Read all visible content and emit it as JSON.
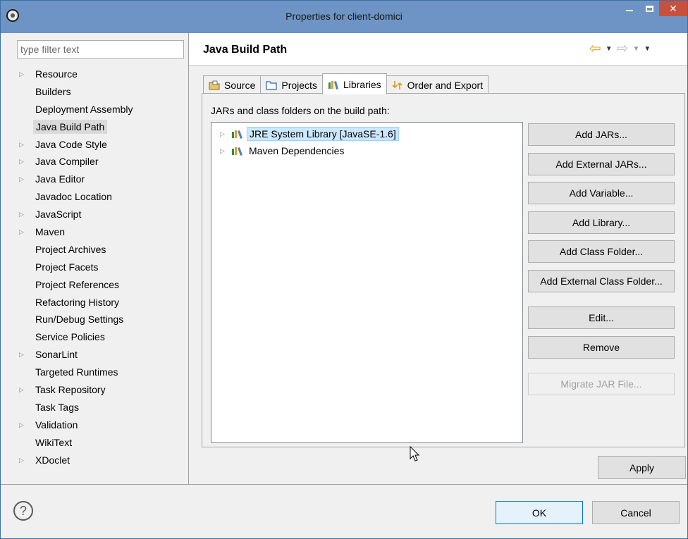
{
  "window": {
    "title": "Properties for client-domici"
  },
  "filter": {
    "placeholder": "type filter text"
  },
  "tree": {
    "items": [
      {
        "label": "Resource",
        "expandable": true
      },
      {
        "label": "Builders",
        "expandable": false
      },
      {
        "label": "Deployment Assembly",
        "expandable": false
      },
      {
        "label": "Java Build Path",
        "expandable": false,
        "selected": true
      },
      {
        "label": "Java Code Style",
        "expandable": true
      },
      {
        "label": "Java Compiler",
        "expandable": true
      },
      {
        "label": "Java Editor",
        "expandable": true
      },
      {
        "label": "Javadoc Location",
        "expandable": false
      },
      {
        "label": "JavaScript",
        "expandable": true
      },
      {
        "label": "Maven",
        "expandable": true
      },
      {
        "label": "Project Archives",
        "expandable": false
      },
      {
        "label": "Project Facets",
        "expandable": false
      },
      {
        "label": "Project References",
        "expandable": false
      },
      {
        "label": "Refactoring History",
        "expandable": false
      },
      {
        "label": "Run/Debug Settings",
        "expandable": false
      },
      {
        "label": "Service Policies",
        "expandable": false
      },
      {
        "label": "SonarLint",
        "expandable": true
      },
      {
        "label": "Targeted Runtimes",
        "expandable": false
      },
      {
        "label": "Task Repository",
        "expandable": true
      },
      {
        "label": "Task Tags",
        "expandable": false
      },
      {
        "label": "Validation",
        "expandable": true
      },
      {
        "label": "WikiText",
        "expandable": false
      },
      {
        "label": "XDoclet",
        "expandable": true
      }
    ]
  },
  "page": {
    "title": "Java Build Path"
  },
  "tabs": {
    "source": "Source",
    "projects": "Projects",
    "libraries": "Libraries",
    "order": "Order and Export",
    "active": "libraries"
  },
  "libraries": {
    "label": "JARs and class folders on the build path:",
    "entries": [
      {
        "label": "JRE System Library [JavaSE-1.6]",
        "selected": true
      },
      {
        "label": "Maven Dependencies",
        "selected": false
      }
    ]
  },
  "buttons": {
    "add_jars": "Add JARs...",
    "add_external_jars": "Add External JARs...",
    "add_variable": "Add Variable...",
    "add_library": "Add Library...",
    "add_class_folder": "Add Class Folder...",
    "add_external_class_folder": "Add External Class Folder...",
    "edit": "Edit...",
    "remove": "Remove",
    "migrate": "Migrate JAR File...",
    "apply": "Apply",
    "ok": "OK",
    "cancel": "Cancel"
  },
  "colors": {
    "titlebar": "#6d94c4",
    "close": "#c7503f",
    "selection": "#cce8ff",
    "nav_back": "#e3a21a"
  }
}
